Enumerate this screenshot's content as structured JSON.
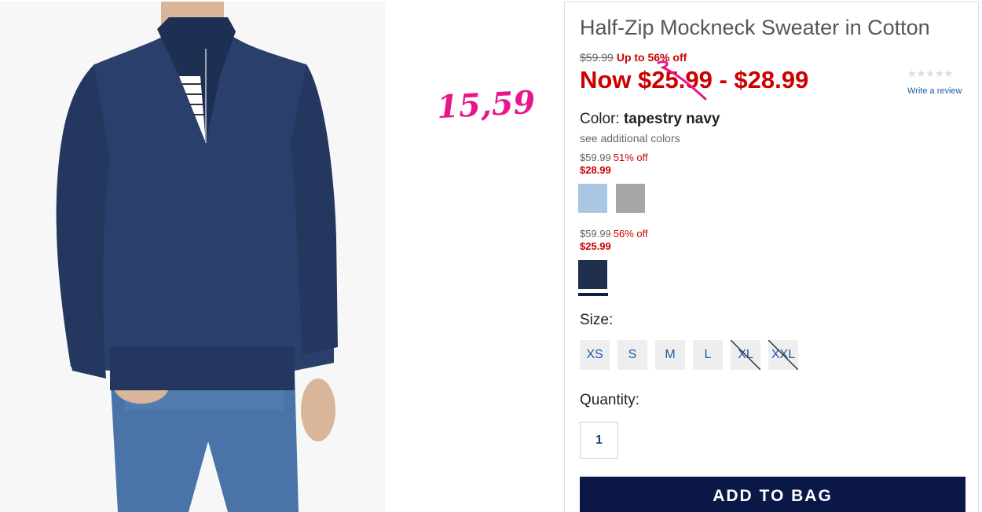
{
  "product": {
    "title": "Half-Zip Mockneck Sweater in Cotton",
    "original_price": "$59.99",
    "discount_text": "Up to 56% off",
    "now_price": "Now $25.99 - $28.99",
    "rating_stars": "★★★★★",
    "write_review": "Write a review"
  },
  "annotation": {
    "handwritten_price": "15,59",
    "color": "#e8168a"
  },
  "color": {
    "label": "Color:",
    "selected": "tapestry navy",
    "see_more": "see additional colors",
    "groups": [
      {
        "old_price": "$59.99",
        "discount": "51% off",
        "sale_price": "$28.99",
        "swatches": [
          {
            "name": "light blue heather",
            "hex": "#a9c6e3"
          },
          {
            "name": "grey heather",
            "hex": "#a6a6a6"
          }
        ]
      },
      {
        "old_price": "$59.99",
        "discount": "56% off",
        "sale_price": "$25.99",
        "swatches": [
          {
            "name": "tapestry navy",
            "hex": "#1f2f4d",
            "selected": true
          }
        ]
      }
    ]
  },
  "size": {
    "label": "Size:",
    "options": [
      {
        "label": "XS",
        "available": true
      },
      {
        "label": "S",
        "available": true
      },
      {
        "label": "M",
        "available": true
      },
      {
        "label": "L",
        "available": true
      },
      {
        "label": "XL",
        "available": false
      },
      {
        "label": "XXL",
        "available": false
      }
    ]
  },
  "quantity": {
    "label": "Quantity:",
    "value": "1"
  },
  "add_to_bag": "ADD TO BAG",
  "colors": {
    "sale_red": "#cc0000",
    "link_blue": "#1b5da8",
    "button_navy": "#0b1747"
  }
}
